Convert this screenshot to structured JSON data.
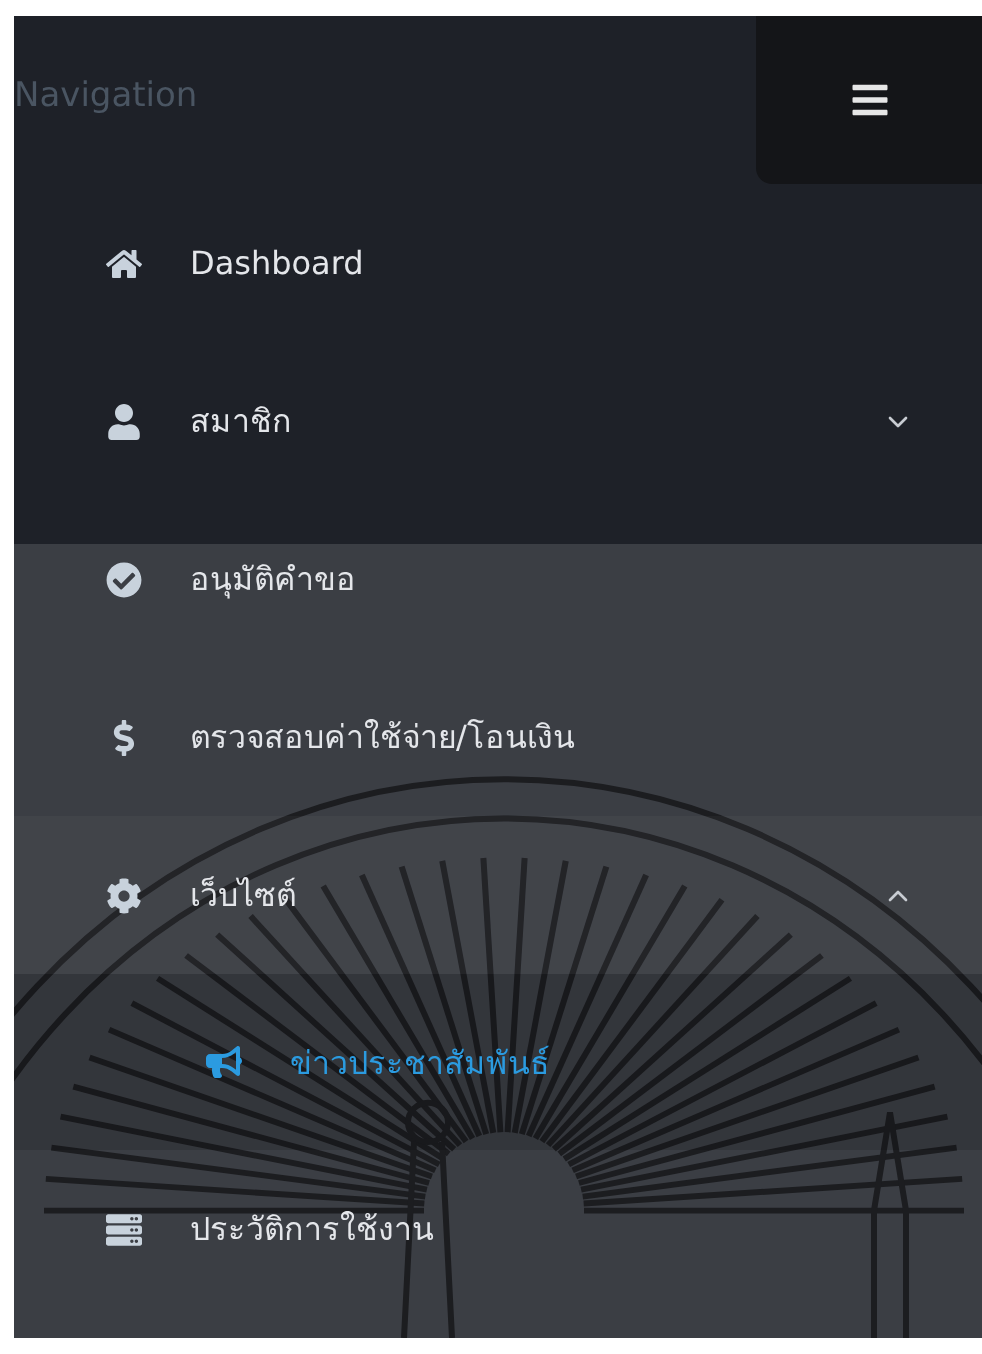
{
  "sidebar": {
    "title": "Navigation",
    "items": [
      {
        "label": "Dashboard",
        "selected": false
      },
      {
        "label": "สมาชิก",
        "selected": false,
        "expanded": false
      },
      {
        "label": "อนุมัติคำขอ",
        "selected": false
      },
      {
        "label": "ตรวจสอบค่าใช้จ่าย/โอนเงิน",
        "selected": false
      },
      {
        "label": "เว็บไซต์",
        "selected": false,
        "expanded": true,
        "children": [
          {
            "label": "ข่าวประชาสัมพันธ์",
            "selected": true
          }
        ]
      },
      {
        "label": "ประวัติการใช้งาน",
        "selected": false
      }
    ]
  }
}
